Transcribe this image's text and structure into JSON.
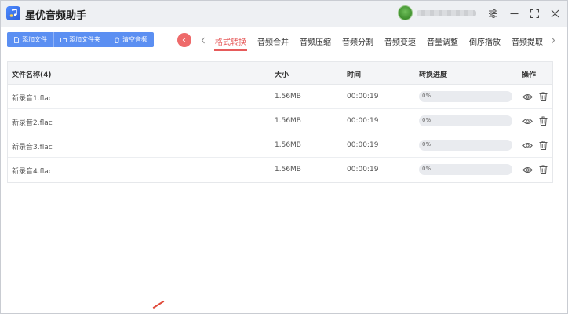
{
  "app": {
    "title": "星优音频助手",
    "user_name": "",
    "colors": {
      "accent": "#5b8ff2",
      "active_tab": "#e65b5b",
      "collapse": "#ee6a6a"
    }
  },
  "window_controls": {
    "settings_icon": "sliders-icon",
    "minimize_icon": "minimize-icon",
    "maximize_icon": "maximize-icon",
    "close_icon": "close-icon"
  },
  "toolbar": {
    "buttons": [
      {
        "label": "添加文件",
        "icon": "file-icon"
      },
      {
        "label": "添加文件夹",
        "icon": "folder-icon"
      },
      {
        "label": "清空音频",
        "icon": "trash-icon"
      }
    ]
  },
  "tabs": [
    {
      "label": "格式转换",
      "active": true
    },
    {
      "label": "音频合并",
      "active": false
    },
    {
      "label": "音频压缩",
      "active": false
    },
    {
      "label": "音频分割",
      "active": false
    },
    {
      "label": "音频变速",
      "active": false
    },
    {
      "label": "音量调整",
      "active": false
    },
    {
      "label": "倒序播放",
      "active": false
    },
    {
      "label": "音频提取",
      "active": false
    }
  ],
  "table": {
    "headers": {
      "name": "文件名称(4)",
      "size": "大小",
      "time": "时间",
      "progress": "转换进度",
      "actions": "操作"
    },
    "rows": [
      {
        "name": "新录音1.flac",
        "size": "1.56MB",
        "time": "00:00:19",
        "progress": "0%"
      },
      {
        "name": "新录音2.flac",
        "size": "1.56MB",
        "time": "00:00:19",
        "progress": "0%"
      },
      {
        "name": "新录音3.flac",
        "size": "1.56MB",
        "time": "00:00:19",
        "progress": "0%"
      },
      {
        "name": "新录音4.flac",
        "size": "1.56MB",
        "time": "00:00:19",
        "progress": "0%"
      }
    ]
  }
}
